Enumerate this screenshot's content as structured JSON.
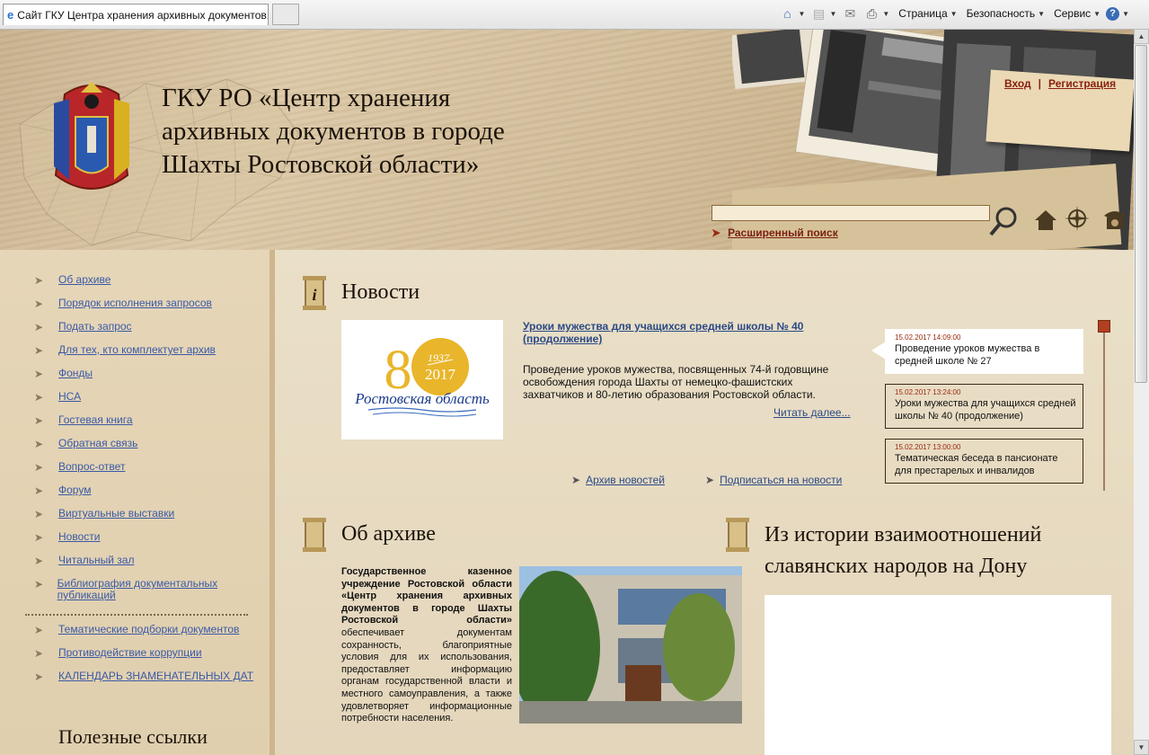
{
  "browser": {
    "tab_title": "Сайт ГКУ Центра хранения архивных документов...",
    "commands": {
      "page": "Страница",
      "security": "Безопасность",
      "tools": "Сервис"
    }
  },
  "header": {
    "title": "ГКУ РО «Центр хранения архивных документов в городе Шахты Ростовской области»",
    "login": "Вход",
    "separator": "|",
    "register": "Регистрация",
    "search_placeholder": "",
    "advanced_search": "Расширенный поиск"
  },
  "sidebar": {
    "items": [
      {
        "label": "Об архиве"
      },
      {
        "label": "Порядок исполнения запросов"
      },
      {
        "label": "Подать запрос"
      },
      {
        "label": "Для тех, кто комплектует архив"
      },
      {
        "label": "Фонды"
      },
      {
        "label": "НСА"
      },
      {
        "label": "Гостевая книга"
      },
      {
        "label": "Обратная связь"
      },
      {
        "label": "Вопрос-ответ"
      },
      {
        "label": "Форум"
      },
      {
        "label": "Виртуальные выставки"
      },
      {
        "label": "Новости"
      },
      {
        "label": "Читальный зал"
      },
      {
        "label": "Библиография документальных публикаций"
      }
    ],
    "items2": [
      {
        "label": "Тематические подборки документов"
      },
      {
        "label": "Противодействие коррупции"
      },
      {
        "label": "КАЛЕНДАРЬ ЗНАМЕНАТЕЛЬНЫХ ДАТ"
      }
    ],
    "useful_links_title": "Полезные ссылки"
  },
  "news": {
    "title": "Новости",
    "image_badge": {
      "years_top": "1937",
      "years_bottom": "2017",
      "number": "80",
      "caption": "Ростовская область"
    },
    "headline": "Уроки мужества для учащихся средней школы № 40 (продолжение)",
    "text": "Проведение уроков мужества, посвященных 74-й годовщине освобождения города Шахты от немецко-фашистских захватчиков и 80-летию образования Ростовской области.",
    "read_more": "Читать далее...",
    "archive_link": "Архив новостей",
    "subscribe_link": "Подписаться на новости",
    "items": [
      {
        "date": "15.02.2017 14:09:00",
        "title": "Проведение уроков мужества в средней школе № 27"
      },
      {
        "date": "15.02.2017 13:24:00",
        "title": "Уроки мужества для учащихся средней школы № 40 (продолжение)"
      },
      {
        "date": "15.02.2017 13:00:00",
        "title": "Тематическая беседа в пансионате для престарелых и инвалидов"
      }
    ]
  },
  "about": {
    "title": "Об архиве",
    "text_bold": "Государственное казенное учреждение Ростовской области «Центр хранения архивных документов в городе Шахты Ростовской области»",
    "text_rest": " обеспечивает документам сохранность, благоприятные условия для их использования, предоставляет информацию органам государственной власти и местного самоуправления, а также удовлетворяет информационные потребности населения."
  },
  "history": {
    "title": "Из истории взаимоотношений славянских народов на Дону"
  },
  "colors": {
    "link": "#3a5aa6",
    "accent": "#8a2010",
    "paper": "#e8dcc4"
  }
}
